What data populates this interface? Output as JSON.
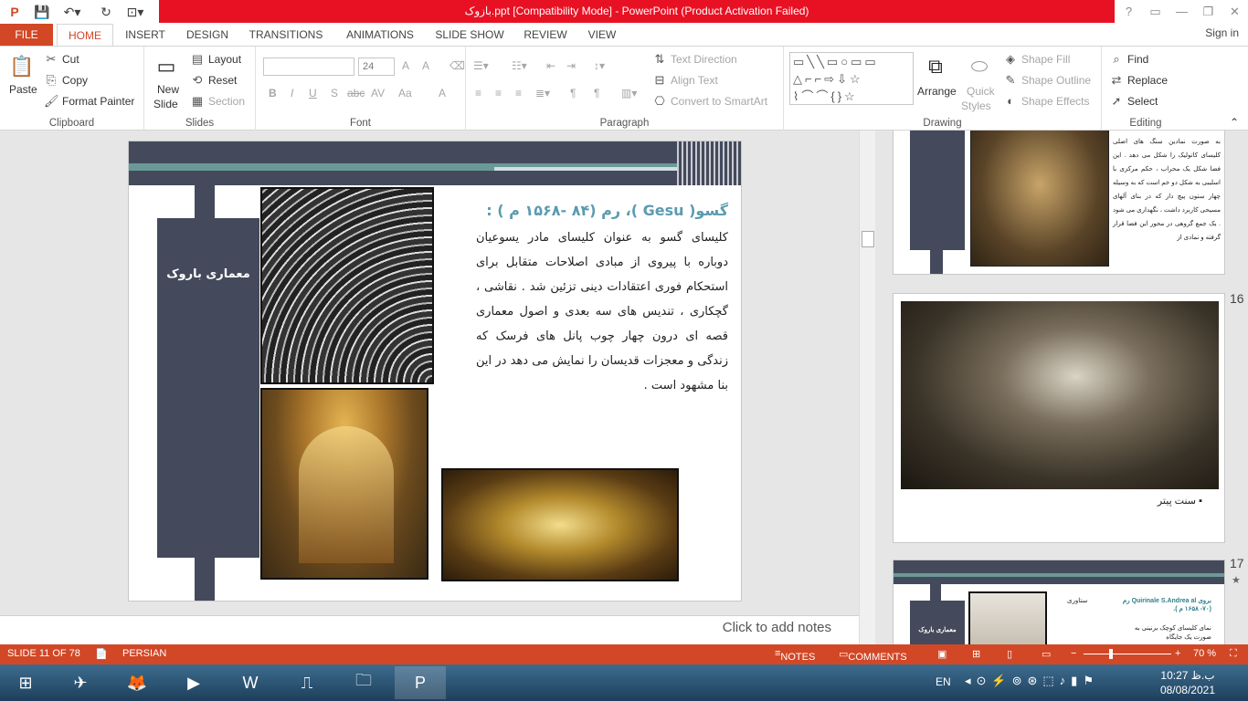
{
  "window": {
    "title": "بازوک.ppt [Compatibility Mode] -  PowerPoint (Product Activation Failed)",
    "controls": [
      "?",
      "▭",
      "—",
      "❐",
      "✕"
    ]
  },
  "tabs": [
    "FILE",
    "HOME",
    "INSERT",
    "DESIGN",
    "TRANSITIONS",
    "ANIMATIONS",
    "SLIDE SHOW",
    "REVIEW",
    "VIEW"
  ],
  "signin": "Sign in",
  "ribbon": {
    "clipboard": {
      "paste": "Paste",
      "cut": "Cut",
      "copy": "Copy",
      "format_painter": "Format Painter",
      "label": "Clipboard"
    },
    "slides": {
      "new_slide_1": "New",
      "new_slide_2": "Slide",
      "layout": "Layout",
      "reset": "Reset",
      "section": "Section",
      "label": "Slides"
    },
    "font": {
      "size": "24",
      "label": "Font",
      "bold": "B",
      "italic": "I",
      "underline": "U",
      "strike": "S",
      "abc": "abc",
      "av": "AV",
      "aa": "Aa",
      "a_color": "A",
      "grow": "A",
      "shrink": "A"
    },
    "paragraph": {
      "text_direction": "Text Direction",
      "align_text": "Align Text",
      "convert_smartart": "Convert to SmartArt",
      "label": "Paragraph"
    },
    "drawing": {
      "arrange": "Arrange",
      "quick_styles_1": "Quick",
      "quick_styles_2": "Styles",
      "shape_fill": "Shape Fill",
      "shape_outline": "Shape Outline",
      "shape_effects": "Shape Effects",
      "label": "Drawing"
    },
    "editing": {
      "find": "Find",
      "replace": "Replace",
      "select": "Select",
      "label": "Editing"
    }
  },
  "slide": {
    "side_title": "معماری باروک",
    "heading": "گسو( Gesu )، رم (۸۴ -۱۵۶۸ م ) :",
    "body": "کلیسای گسو به عنوان کلیسای مادر یسوعیان دوباره با پیروی  از مبادی اصلاحات متقابل برای استحکام فوری اعتقادات دینی تزئین شد . نقاشی ، گچکاری ، تندیس های سه بعدی و اصول معماری قصه ای درون چهار چوب پانل های فرسک که زندگی و معجزات قدیسان را نمایش می دهد در این بنا مشهود است ."
  },
  "notes_placeholder": "Click to add notes",
  "thumbnails": [
    {
      "number": "",
      "text": "به صورت نمادین سنگ های اصلی کلیسای کاتولیک را شکل می دهد . این فضا شکل یک محراب ، حکم مرکزی با اسلیبی به شکل دو خم است که به وسیله چهار ستون پیچ دار که در بنای آلهای مسیحی کاربرد داشت ، نگهداری می شود . یک جمع گروهی در محور این فضا قرار گرفته و نمادی از"
    },
    {
      "number": "16",
      "caption": "سنت پیتر"
    },
    {
      "number": "17",
      "side_title": "معماری باروک",
      "label1": "ستاوری",
      "label2": "بروی Quirinale S.Andrea al رم (۷۰- ۱۶۵۸ م ).",
      "label3": "نمای کلیسای کوچک برنینی به صورت یک جایگاه"
    }
  ],
  "status": {
    "slide_info": "SLIDE 11 OF 78",
    "language": "PERSIAN",
    "notes": "NOTES",
    "comments": "COMMENTS",
    "zoom": "70 %"
  },
  "taskbar": {
    "lang": "EN",
    "time": "10:27 ب.ظ",
    "date": "08/08/2021"
  }
}
